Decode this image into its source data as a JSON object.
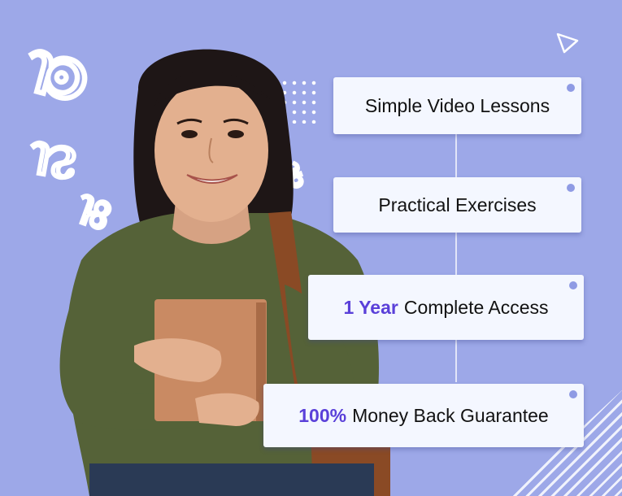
{
  "colors": {
    "background": "#9DA8E8",
    "card": "#F4F7FF",
    "highlight": "#5A40D9",
    "text": "#121212",
    "shirt": "#556238",
    "book": "#C98A63"
  },
  "features": [
    {
      "highlight": "",
      "text": "Simple Video Lessons"
    },
    {
      "highlight": "",
      "text": "Practical Exercises"
    },
    {
      "highlight": "1 Year",
      "text": "Complete Access"
    },
    {
      "highlight": "100%",
      "text": "Money Back Guarantee"
    }
  ],
  "decor": {
    "glyphs": [
      "ಠ",
      "ನ",
      "ಹ",
      "ಕ"
    ],
    "triangle_icon": "play-triangle-icon"
  }
}
